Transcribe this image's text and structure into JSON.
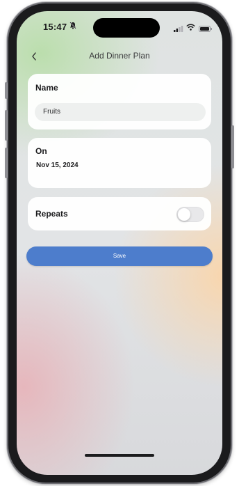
{
  "status_bar": {
    "time": "15:47",
    "bell_icon": "bell-slash-icon",
    "signal_icon": "cellular-signal-icon",
    "wifi_icon": "wifi-icon",
    "battery_icon": "battery-icon"
  },
  "nav": {
    "back_icon": "chevron-left-icon",
    "title": "Add Dinner Plan"
  },
  "form": {
    "name_label": "Name",
    "name_value": "Fruits",
    "on_label": "On",
    "date_value": "Nov 15, 2024",
    "repeats_label": "Repeats",
    "repeats_on": false,
    "save_label": "Save"
  },
  "colors": {
    "accent": "#4d7dcc",
    "card": "#ffffff",
    "text": "#1c1c1e"
  }
}
